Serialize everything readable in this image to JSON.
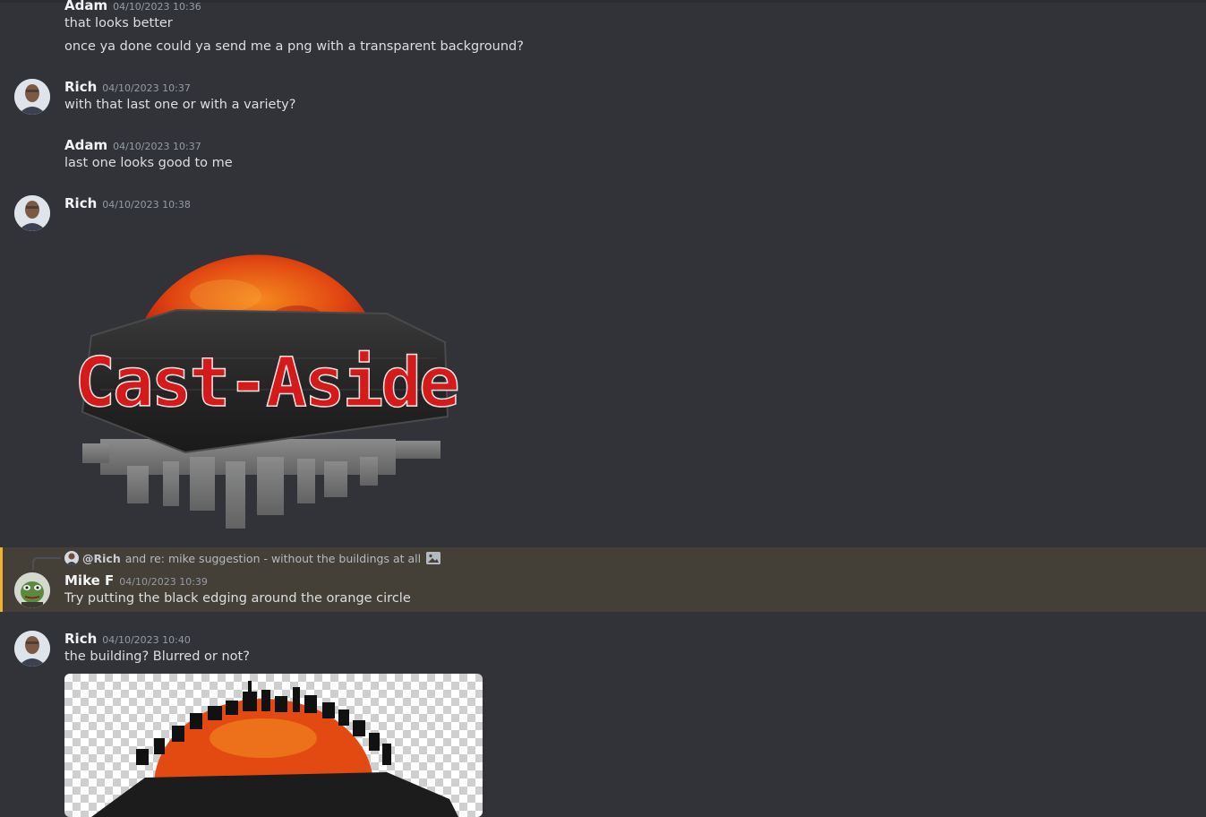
{
  "messages": [
    {
      "author": "Adam",
      "timestamp": "04/10/2023 10:36",
      "lines": [
        "that looks better",
        "once ya done could ya send me a png with a transparent background?"
      ]
    },
    {
      "author": "Rich",
      "timestamp": "04/10/2023 10:37",
      "lines": [
        "with that last one or with a variety?"
      ]
    },
    {
      "author": "Adam",
      "timestamp": "04/10/2023 10:37",
      "lines": [
        "last one looks good to me"
      ]
    },
    {
      "author": "Rich",
      "timestamp": "04/10/2023 10:38",
      "image_text": "Cast-Aside"
    },
    {
      "reply": {
        "author": "@Rich",
        "text": "and re: mike suggestion - without the buildings at all"
      },
      "author": "Mike F",
      "timestamp": "04/10/2023 10:39",
      "lines": [
        "Try putting the black edging around the orange circle"
      ]
    },
    {
      "author": "Rich",
      "timestamp": "04/10/2023 10:40",
      "lines": [
        "the building? Blurred or not?"
      ]
    }
  ],
  "colors": {
    "background": "#313338",
    "mention_highlight": "#444037",
    "mention_bar": "#f0b232",
    "logo_red": "#d41a1a",
    "sun_orange": "#e8571a"
  }
}
